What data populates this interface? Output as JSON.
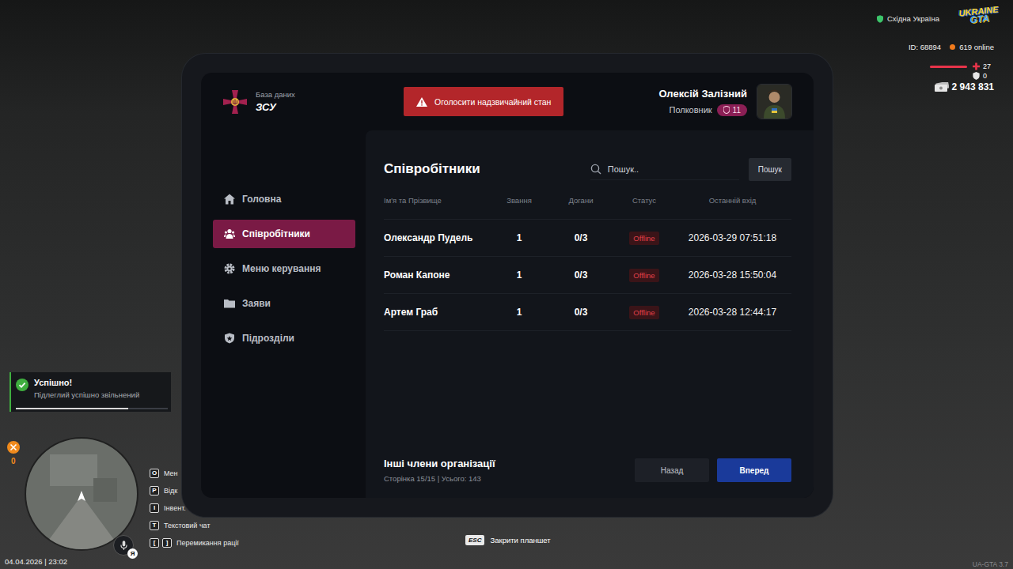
{
  "hud": {
    "region": "Східна Україна",
    "logo": {
      "top": "UKRAINE",
      "bottom": "GTA"
    },
    "player_id": "ID: 68894",
    "online": "619 online",
    "health": "27",
    "health_level": 1,
    "armor": "0",
    "money": "2 943 831",
    "weapon_count": "0",
    "date_time": "04.04.2026 | 23:02",
    "voice_key": "Я",
    "version": "UA-GTA 3.7"
  },
  "hotkeys": [
    {
      "keys": [
        "O"
      ],
      "label": "Мен"
    },
    {
      "keys": [
        "P"
      ],
      "label": "Відк"
    },
    {
      "keys": [
        "I"
      ],
      "label": "Інвент."
    },
    {
      "keys": [
        "T"
      ],
      "label": "Текстовий чат"
    },
    {
      "keys": [
        "[",
        "]"
      ],
      "label": "Перемикання рації"
    }
  ],
  "close_hint": {
    "key": "ESC",
    "label": "Закрити планшет"
  },
  "notification": {
    "title": "Успішно!",
    "message": "Підлеглий успішно звільнений",
    "level": 0.74
  },
  "tablet": {
    "brand": {
      "subtitle": "База даних",
      "title": "ЗСУ"
    },
    "alert_button": "Оголосити надзвичайний стан",
    "user": {
      "name": "Олексій Залізний",
      "rank": "Полковник",
      "level": "11"
    },
    "sidebar": {
      "items": [
        {
          "label": "Головна",
          "selected": false
        },
        {
          "label": "Співробітники",
          "selected": true
        },
        {
          "label": "Меню керування",
          "selected": false
        },
        {
          "label": "Заяви",
          "selected": false
        },
        {
          "label": "Підрозділи",
          "selected": false
        }
      ]
    },
    "page": {
      "title": "Співробітники",
      "search": {
        "placeholder": "Пошук..",
        "button": "Пошук"
      },
      "table": {
        "columns": [
          "Ім'я та Прізвище",
          "Звання",
          "Догани",
          "Статус",
          "Останній вхід"
        ],
        "rows": [
          {
            "name": "Олександр Пудель",
            "rank": "1",
            "reprimands": "0/3",
            "status": "Offline",
            "last_login": "2026-03-29 07:51:18"
          },
          {
            "name": "Роман Капоне",
            "rank": "1",
            "reprimands": "0/3",
            "status": "Offline",
            "last_login": "2026-03-28 15:50:04"
          },
          {
            "name": "Артем Граб",
            "rank": "1",
            "reprimands": "0/3",
            "status": "Offline",
            "last_login": "2026-03-28 12:44:17"
          }
        ]
      },
      "footer": {
        "title": "Інші члени організації",
        "info": "Сторінка 15/15 | Усього: 143",
        "prev": "Назад",
        "next": "Вперед"
      }
    }
  }
}
